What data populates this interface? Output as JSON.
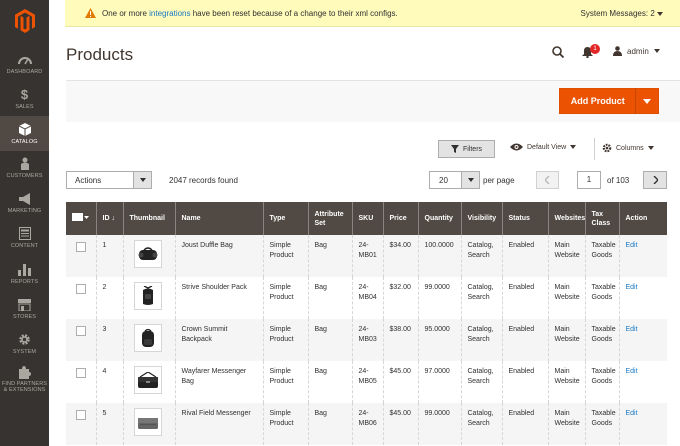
{
  "sidebar": {
    "logo": "magento-logo",
    "items": [
      {
        "label": "DASHBOARD",
        "icon": "dashboard-icon"
      },
      {
        "label": "SALES",
        "icon": "dollar-icon"
      },
      {
        "label": "CATALOG",
        "icon": "catalog-cube-icon",
        "active": true
      },
      {
        "label": "CUSTOMERS",
        "icon": "person-icon"
      },
      {
        "label": "MARKETING",
        "icon": "megaphone-icon"
      },
      {
        "label": "CONTENT",
        "icon": "content-icon"
      },
      {
        "label": "REPORTS",
        "icon": "bar-chart-icon"
      },
      {
        "label": "STORES",
        "icon": "store-icon"
      },
      {
        "label": "SYSTEM",
        "icon": "gear-icon"
      },
      {
        "label_line1": "FIND PARTNERS",
        "label_line2": "& EXTENSIONS",
        "icon": "puzzle-icon"
      }
    ]
  },
  "message_bar": {
    "text_before": "One or more ",
    "link": "integrations",
    "text_after": " have been reset because of a change to their xml configs.",
    "system_messages": "System Messages: 2"
  },
  "header": {
    "title": "Products",
    "notification_count": "1",
    "user": "admin"
  },
  "toolbar": {
    "add_product": "Add Product",
    "filters": "Filters",
    "view": "Default View",
    "columns": "Columns",
    "actions": "Actions",
    "records_found": "2047 records found",
    "per_page_value": "20",
    "per_page_label": "per page",
    "page": "1",
    "of_pages": "of 103"
  },
  "table": {
    "headers": [
      "ID",
      "Thumbnail",
      "Name",
      "Type",
      "Attribute Set",
      "SKU",
      "Price",
      "Quantity",
      "Visibility",
      "Status",
      "Websites",
      "Tax Class",
      "Action"
    ],
    "rows": [
      {
        "id": "1",
        "name": "Joust Duffle Bag",
        "type": "Simple Product",
        "attribute_set": "Bag",
        "sku": "24-MB01",
        "price": "$34.00",
        "quantity": "100.0000",
        "visibility": "Catalog, Search",
        "status": "Enabled",
        "websites": "Main Website",
        "tax_class": "Taxable Goods",
        "action": "Edit",
        "thumb": "duffle"
      },
      {
        "id": "2",
        "name": "Strive Shoulder Pack",
        "type": "Simple Product",
        "attribute_set": "Bag",
        "sku": "24-MB04",
        "price": "$32.00",
        "quantity": "99.0000",
        "visibility": "Catalog, Search",
        "status": "Enabled",
        "websites": "Main Website",
        "tax_class": "Taxable Goods",
        "action": "Edit",
        "thumb": "shoulder"
      },
      {
        "id": "3",
        "name": "Crown Summit Backpack",
        "type": "Simple Product",
        "attribute_set": "Bag",
        "sku": "24-MB03",
        "price": "$38.00",
        "quantity": "95.0000",
        "visibility": "Catalog, Search",
        "status": "Enabled",
        "websites": "Main Website",
        "tax_class": "Taxable Goods",
        "action": "Edit",
        "thumb": "backpack"
      },
      {
        "id": "4",
        "name": "Wayfarer Messenger Bag",
        "type": "Simple Product",
        "attribute_set": "Bag",
        "sku": "24-MB05",
        "price": "$45.00",
        "quantity": "97.0000",
        "visibility": "Catalog, Search",
        "status": "Enabled",
        "websites": "Main Website",
        "tax_class": "Taxable Goods",
        "action": "Edit",
        "thumb": "messenger"
      },
      {
        "id": "5",
        "name": "Rival Field Messenger",
        "type": "Simple Product",
        "attribute_set": "Bag",
        "sku": "24-MB06",
        "price": "$45.00",
        "quantity": "99.0000",
        "visibility": "Catalog, Search",
        "status": "Enabled",
        "websites": "Main Website",
        "tax_class": "Taxable Goods",
        "action": "Edit",
        "thumb": "field"
      }
    ]
  },
  "colors": {
    "sidebar_bg": "#373330",
    "accent": "#eb5202",
    "table_header": "#514943",
    "link": "#1979c3",
    "message_bg": "#fffbbb"
  }
}
